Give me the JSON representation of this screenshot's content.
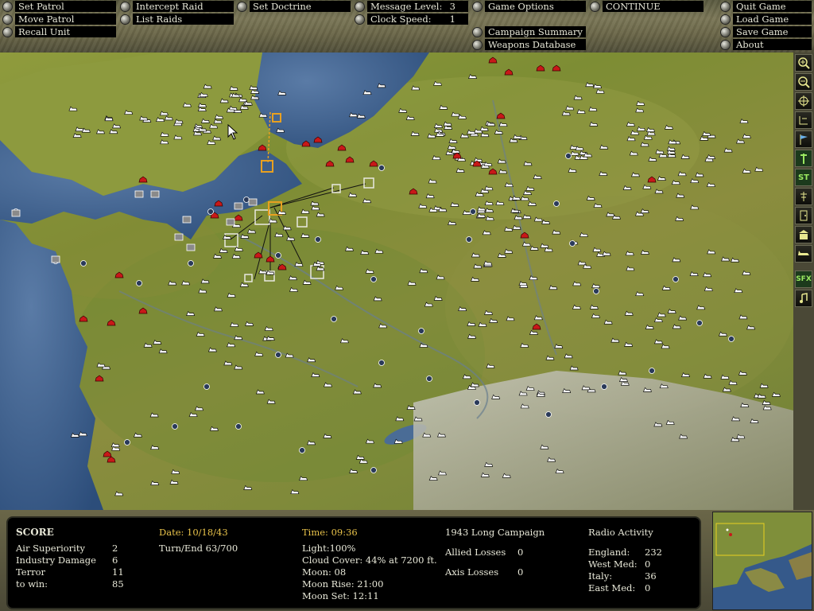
{
  "toolbar": {
    "set_patrol": "Set Patrol",
    "move_patrol": "Move Patrol",
    "recall_unit": "Recall Unit",
    "intercept_raid": "Intercept Raid",
    "list_raids": "List Raids",
    "set_doctrine": "Set Doctrine",
    "message_level_label": "Message Level:",
    "message_level_value": "3",
    "clock_speed_label": "Clock Speed:",
    "clock_speed_value": "1",
    "game_options": "Game Options",
    "continue": "CONTINUE",
    "campaign_summary": "Campaign Summary",
    "weapons_database": "Weapons Database",
    "quit_game": "Quit Game",
    "load_game": "Load Game",
    "save_game": "Save Game",
    "about": "About"
  },
  "sidebar": {
    "st_label": "ST",
    "sfx_label": "SFX",
    "icons": [
      "zoom-in-icon",
      "zoom-out-icon",
      "crosshair-icon",
      "grid-icon",
      "flag-icon",
      "route-icon",
      "st-toggle",
      "pin-icon",
      "door-icon",
      "building-icon",
      "plane-icon",
      "sfx-toggle",
      "music-icon"
    ]
  },
  "score": {
    "heading": "SCORE",
    "rows": [
      {
        "label": "Air Superiority",
        "value": "2"
      },
      {
        "label": "Industry Damage",
        "value": "6"
      },
      {
        "label": "Terror",
        "value": "11"
      },
      {
        "label": "to win:",
        "value": "85"
      }
    ]
  },
  "date": {
    "date": "Date: 10/18/43",
    "turn": "Turn/End  63/700"
  },
  "conditions": {
    "time": "Time: 09:36",
    "light": "Light:100%",
    "cloud": "Cloud Cover: 44% at 7200 ft.",
    "moon": "Moon: 08",
    "moon_rise": "Moon Rise: 21:00",
    "moon_set": "Moon Set: 12:11"
  },
  "campaign": {
    "title": "1943 Long Campaign",
    "allied_label": "Allied Losses",
    "allied_value": "0",
    "axis_label": "Axis Losses",
    "axis_value": "0"
  },
  "radio": {
    "heading": "Radio Activity",
    "rows": [
      {
        "label": "England:",
        "value": "232"
      },
      {
        "label": "West Med:",
        "value": "0"
      },
      {
        "label": "Italy:",
        "value": "36"
      },
      {
        "label": "East Med:",
        "value": "0"
      }
    ]
  },
  "colors": {
    "allied_unit": "#ffffff",
    "axis_unit": "#c81818",
    "selected": "#e8a020",
    "panel_text": "#e8e8d8",
    "highlight_text": "#e8c24a"
  }
}
